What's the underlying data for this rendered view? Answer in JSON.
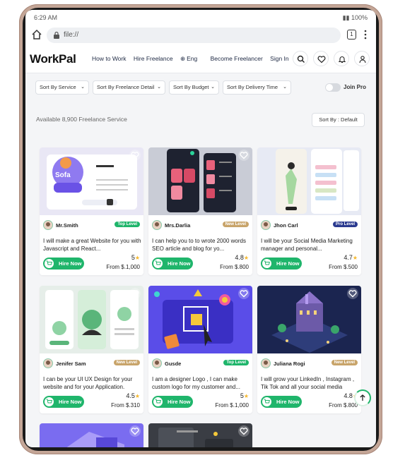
{
  "status_bar": {
    "time": "6:29 AM",
    "battery": "100%"
  },
  "browser": {
    "url": "file://",
    "tab_count": "1"
  },
  "nav": {
    "logo": "WorkPal",
    "links": [
      "How to Work",
      "Hire Freelance",
      "Eng",
      "Become Freelancer",
      "Sign In"
    ]
  },
  "filters": {
    "items": [
      "Sort By Service",
      "Sort By Freelance Detail",
      "Sort By Budget",
      "Sort By Delivery Time"
    ],
    "join_pro": "Join Pro"
  },
  "results": {
    "available_text": "Available 8,900 Freelance Service",
    "sort_label": "Sort By :  Default"
  },
  "colors": {
    "accent": "#1fb56b",
    "top_level": "#1fb56b",
    "new_level": "#c8a46a",
    "pro_level": "#2a3a8f"
  },
  "cards": [
    {
      "seller": "Mr.Smith",
      "level": "Top Level",
      "desc": "I will make a great Website for you with Javascript and React...",
      "rating": "5",
      "price": "From $.1,000",
      "hire": "Hire Now"
    },
    {
      "seller": "Mrs.Darlia",
      "level": "New Level",
      "desc": "I can help you to to wrote 2000 words SEO article and blog for yo...",
      "rating": "4.8",
      "price": "From $.800",
      "hire": "Hire Now"
    },
    {
      "seller": "Jhon Carl",
      "level": "Pro Level",
      "desc": "I will be your Social Media Marketing manager and personal...",
      "rating": "4.7",
      "price": "From $.500",
      "hire": "Hire Now"
    },
    {
      "seller": "Jenifer Sam",
      "level": "New Level",
      "desc": "I can be your UI UX Design for your website and for your Application.",
      "rating": "4.5",
      "price": "From $.310",
      "hire": "Hire Now"
    },
    {
      "seller": "Gusde",
      "level": "Top Level",
      "desc": "I am a designer Logo , I can make custom logo for my customer and...",
      "rating": "5",
      "price": "From $.1,000",
      "hire": "Hire Now"
    },
    {
      "seller": "Juliana Rogi",
      "level": "New Level",
      "desc": "I will grow your LinkedIn , Instagram , Tik Tok and all your social media",
      "rating": "4.8",
      "price": "From $.800",
      "hire": "Hire Now"
    }
  ]
}
